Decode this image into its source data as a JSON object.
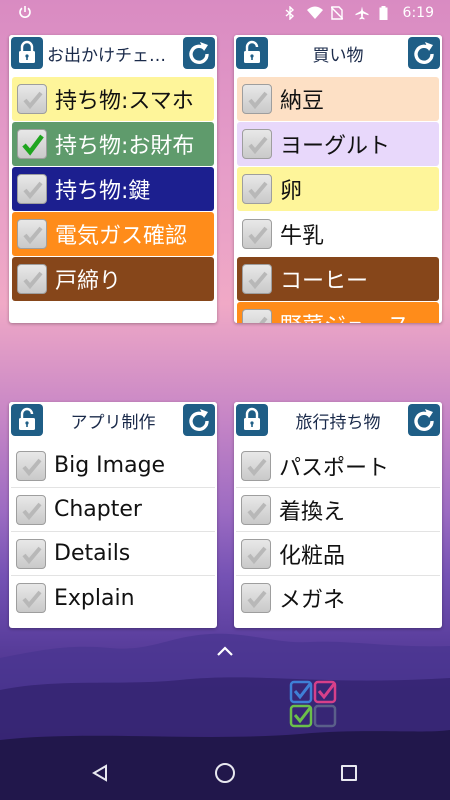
{
  "status_bar": {
    "time": "6:19",
    "icons": [
      "power-icon",
      "bluetooth-icon",
      "wifi-icon",
      "no-sim-icon",
      "airplane-icon",
      "battery-icon"
    ]
  },
  "colors": {
    "widget_button_bg": "#1f5e86",
    "yellow": "#fef59a",
    "green": "#5f9b6c",
    "navy": "#1c1f8f",
    "orange": "#ff8c1a",
    "brown": "#86461a",
    "peach": "#fde0c5",
    "lavender": "#e8d8fb"
  },
  "widgets": [
    {
      "title": "お出かけチェ…",
      "locked": true,
      "items": [
        {
          "label": "持ち物:スマホ",
          "checked": false,
          "bg": "#fef59a",
          "fg": "#111111"
        },
        {
          "label": "持ち物:お財布",
          "checked": true,
          "bg": "#5f9b6c",
          "fg": "#ffffff"
        },
        {
          "label": "持ち物:鍵",
          "checked": false,
          "bg": "#1c1f8f",
          "fg": "#ffffff"
        },
        {
          "label": "電気ガス確認",
          "checked": false,
          "bg": "#ff8c1a",
          "fg": "#ffffff"
        },
        {
          "label": "戸締り",
          "checked": false,
          "bg": "#86461a",
          "fg": "#ffffff"
        }
      ]
    },
    {
      "title": "買い物",
      "locked": false,
      "items": [
        {
          "label": "納豆",
          "checked": false,
          "bg": "#fde0c5",
          "fg": "#111111"
        },
        {
          "label": "ヨーグルト",
          "checked": false,
          "bg": "#e8d8fb",
          "fg": "#111111"
        },
        {
          "label": "卵",
          "checked": false,
          "bg": "#fef59a",
          "fg": "#111111"
        },
        {
          "label": "牛乳",
          "checked": false,
          "bg": "#ffffff",
          "fg": "#111111"
        },
        {
          "label": "コーヒー",
          "checked": false,
          "bg": "#86461a",
          "fg": "#ffffff"
        },
        {
          "label": "野菜ジュース",
          "checked": false,
          "bg": "#ff8c1a",
          "fg": "#ffffff"
        }
      ]
    },
    {
      "title": "アプリ制作",
      "locked": false,
      "items": [
        {
          "label": "Big Image",
          "checked": false
        },
        {
          "label": "Chapter",
          "checked": false
        },
        {
          "label": "Details",
          "checked": false
        },
        {
          "label": "Explain",
          "checked": false
        }
      ]
    },
    {
      "title": "旅行持ち物",
      "locked": true,
      "items": [
        {
          "label": "パスポート",
          "checked": false
        },
        {
          "label": "着換え",
          "checked": false
        },
        {
          "label": "化粧品",
          "checked": false
        },
        {
          "label": "メガネ",
          "checked": false
        }
      ]
    }
  ]
}
